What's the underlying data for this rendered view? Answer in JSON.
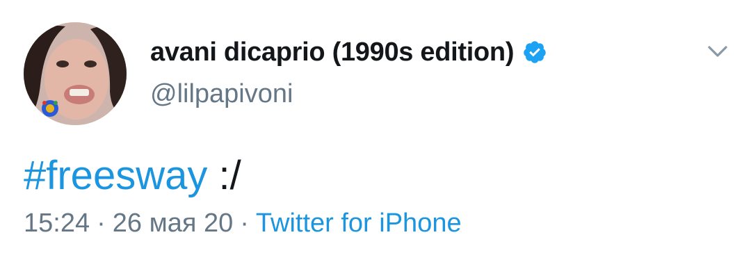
{
  "user": {
    "display_name": "avani dicaprio (1990s edition)",
    "handle": "@lilpapivoni",
    "verified": true,
    "avatar_icon": "profile-photo"
  },
  "tweet": {
    "hashtag": "#freesway",
    "text_after": " :/"
  },
  "meta": {
    "time": "15:24",
    "date": "26 мая 20",
    "separator": "·",
    "source": "Twitter for iPhone"
  },
  "icons": {
    "verified": "verified-badge-icon",
    "menu": "chevron-down-icon"
  },
  "colors": {
    "link": "#1b95e0",
    "text": "#14171a",
    "secondary": "#657786",
    "verified": "#1da1f2"
  }
}
